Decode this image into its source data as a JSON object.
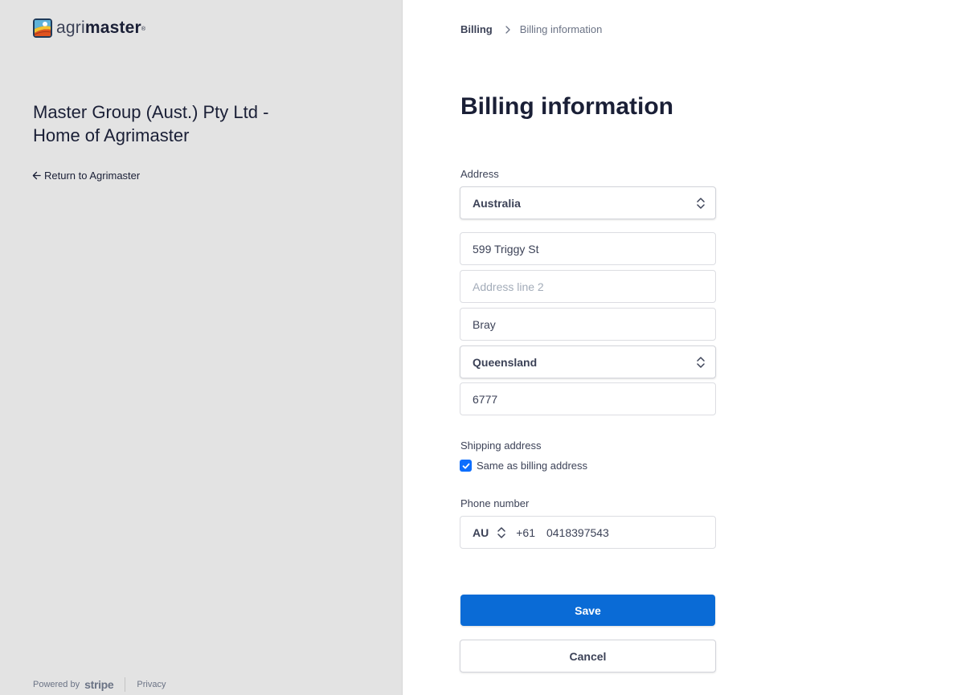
{
  "brand": {
    "logo_light": "agri",
    "logo_bold": "master",
    "logo_mark": "®",
    "logo_icon": "agrimaster-logo-icon"
  },
  "left_panel": {
    "company_name": "Master Group (Aust.) Pty Ltd - Home of Agrimaster",
    "return_label": "Return to Agrimaster",
    "return_icon": "arrow-left-icon"
  },
  "footer": {
    "powered_by": "Powered by",
    "stripe": "stripe",
    "privacy": "Privacy"
  },
  "breadcrumb": {
    "items": [
      "Billing",
      "Billing information"
    ],
    "separator_icon": "chevron-right-icon"
  },
  "page_title": "Billing information",
  "address": {
    "label": "Address",
    "country": "Australia",
    "line1": "599 Triggy St",
    "line2_placeholder": "Address line 2",
    "city": "Bray",
    "state": "Queensland",
    "postcode": "6777"
  },
  "shipping": {
    "label": "Shipping address",
    "same_as_billing_label": "Same as billing address",
    "same_as_billing_checked": true
  },
  "phone": {
    "label": "Phone number",
    "country_code": "AU",
    "dial_code": "+61",
    "number": "0418397543"
  },
  "buttons": {
    "save": "Save",
    "cancel": "Cancel"
  },
  "colors": {
    "left_bg": "#e3e3e3",
    "primary": "#0a6bd6",
    "checkbox": "#0d6efd"
  }
}
